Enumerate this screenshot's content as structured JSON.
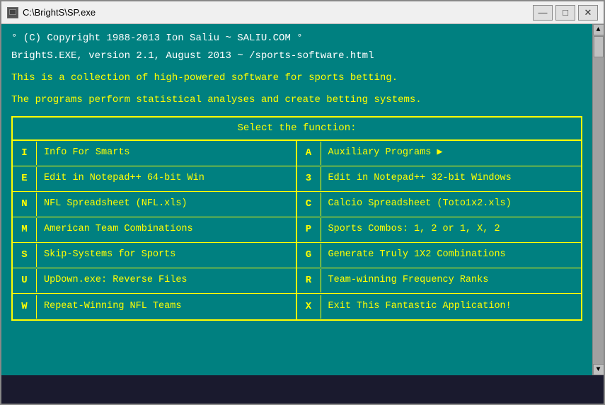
{
  "window": {
    "title": "C:\\BrightS\\SP.exe",
    "icon": "■"
  },
  "titlebar": {
    "minimize": "—",
    "maximize": "□",
    "close": "✕"
  },
  "header": {
    "line1": "° (C) Copyright 1988-2013 Ion Saliu ~ SALIU.COM °",
    "line2": "BrightS.EXE, version 2.1, August 2013 ~ /sports-software.html",
    "line3": "",
    "line4": "This is a collection of high-powered software for sports betting.",
    "line5": "",
    "line6": "The programs perform statistical analyses and create betting systems."
  },
  "menu": {
    "header": "Select the function:",
    "left": [
      {
        "key": "I",
        "label": "Info For Smarts"
      },
      {
        "key": "E",
        "label": "Edit in Notepad++ 64-bit Win"
      },
      {
        "key": "N",
        "label": "NFL Spreadsheet (NFL.xls)"
      },
      {
        "key": "M",
        "label": "American Team Combinations"
      },
      {
        "key": "S",
        "label": "Skip-Systems for Sports"
      },
      {
        "key": "U",
        "label": "UpDown.exe: Reverse Files"
      },
      {
        "key": "W",
        "label": "Repeat-Winning NFL Teams"
      }
    ],
    "right": [
      {
        "key": "A",
        "label": "Auxiliary Programs",
        "arrow": true
      },
      {
        "key": "3",
        "label": "Edit in Notepad++ 32-bit Windows"
      },
      {
        "key": "C",
        "label": "Calcio Spreadsheet (Toto1x2.xls)"
      },
      {
        "key": "P",
        "label": "Sports Combos:  1, 2 or 1, X, 2"
      },
      {
        "key": "G",
        "label": "Generate Truly 1X2 Combinations"
      },
      {
        "key": "R",
        "label": "Team-winning Frequency Ranks"
      },
      {
        "key": "X",
        "label": "Exit This Fantastic Application!"
      }
    ]
  }
}
